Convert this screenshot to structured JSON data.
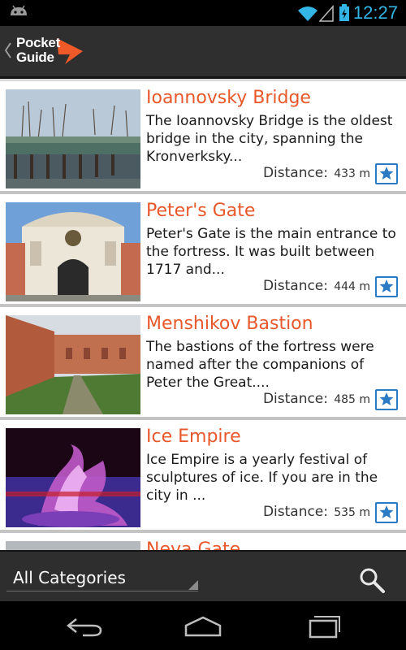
{
  "status_bar": {
    "time": "12:27",
    "icons": [
      "android-icon",
      "wifi-icon",
      "signal-icon",
      "battery-icon"
    ],
    "time_color": "#33b5e5"
  },
  "action_bar": {
    "logo_line1": "Pocket",
    "logo_line2": "Guide",
    "logo_accent": "#f05a28",
    "up_icon": "chevron-left-icon"
  },
  "places": [
    {
      "title": "Ioannovsky Bridge",
      "description": "The Ioannovsky Bridge is the oldest bridge in the city, spanning the Kronverksky...",
      "distance_label": "Distance:",
      "distance_value": "433 m"
    },
    {
      "title": "Peter's Gate",
      "description": "Peter's Gate is the main entrance to the fortress. It was built between 1717 and...",
      "distance_label": "Distance:",
      "distance_value": "444 m"
    },
    {
      "title": "Menshikov Bastion",
      "description": "The bastions of the fortress were named after the companions of Peter the Great....",
      "distance_label": "Distance:",
      "distance_value": "485 m"
    },
    {
      "title": "Ice Empire",
      "description": "Ice Empire is a yearly festival of sculptures of ice. If you are in the city in ...",
      "distance_label": "Distance:",
      "distance_value": "535 m"
    },
    {
      "title": "Neva Gate",
      "description": "",
      "distance_label": "",
      "distance_value": ""
    }
  ],
  "category_bar": {
    "selected_category": "All Categories",
    "search_icon": "search-icon"
  },
  "nav_bar": {
    "buttons": [
      "back-icon",
      "home-icon",
      "recent-apps-icon"
    ]
  },
  "colors": {
    "title": "#e8582b",
    "action_bar_bg": "#2f2f2f",
    "favorite_button": "#2b7bc4"
  }
}
